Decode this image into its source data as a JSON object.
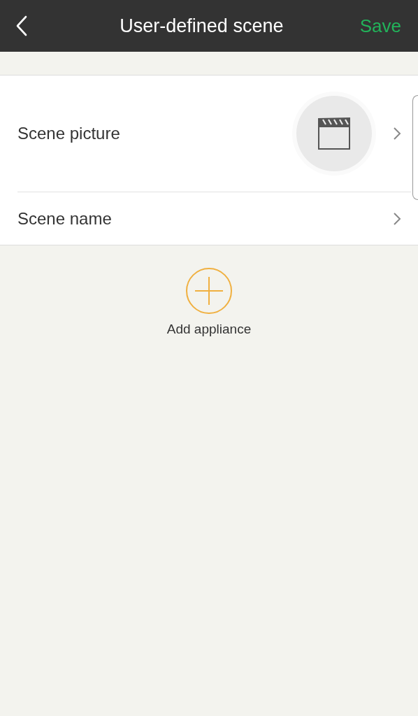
{
  "header": {
    "title": "User-defined scene",
    "save": "Save"
  },
  "rows": [
    {
      "kind": "picture",
      "label": "Scene picture"
    },
    {
      "kind": "plain",
      "label": "Scene name"
    }
  ],
  "add": {
    "label": "Add appliance"
  }
}
